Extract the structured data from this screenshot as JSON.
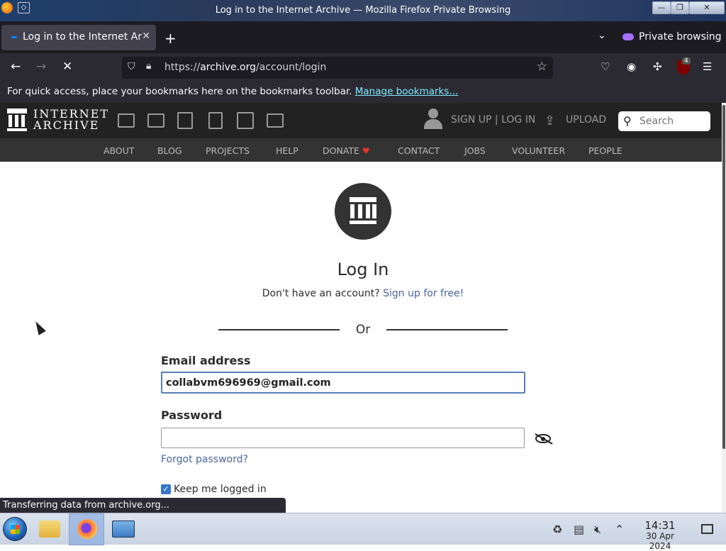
{
  "window": {
    "title": "Log in to the Internet Archive — Mozilla Firefox Private Browsing",
    "buttons": [
      "—",
      "❐",
      "✕"
    ]
  },
  "tabs": [
    {
      "title": "Log in to the Internet Archive",
      "close": "✕"
    }
  ],
  "tabstrip": {
    "new_tab": "+",
    "list_all": "⌄",
    "private_label": "Private browsing"
  },
  "navbar": {
    "back": "←",
    "forward": "→",
    "stop": "✕",
    "url_prefix": "https://",
    "url_host": "archive.org",
    "url_path": "/account/login",
    "ublock_count": "4"
  },
  "bookmarks": {
    "message": "For quick access, place your bookmarks here on the bookmarks toolbar.",
    "link": "Manage bookmarks..."
  },
  "ia_header": {
    "logo_line1": "INTERNET",
    "logo_line2": "ARCHIVE",
    "auth": "SIGN UP | LOG IN",
    "upload": "UPLOAD",
    "search_placeholder": "Search"
  },
  "ia_nav": [
    "ABOUT",
    "BLOG",
    "PROJECTS",
    "HELP",
    "DONATE",
    "CONTACT",
    "JOBS",
    "VOLUNTEER",
    "PEOPLE"
  ],
  "login": {
    "heading": "Log In",
    "no_account": "Don't have an account?",
    "signup_link": "Sign up for free!",
    "or": "Or",
    "email_label": "Email address",
    "email_value": "collabvm696969@gmail.com",
    "password_label": "Password",
    "password_value": "",
    "forgot": "Forgot password?",
    "keep_logged_in": "Keep me logged in",
    "keep_logged_in_checked": true
  },
  "status": "Transferring data from archive.org...",
  "taskbar": {
    "time": "14:31",
    "date": "30 Apr 2024"
  },
  "colors": {
    "ia_header_bg": "#222222",
    "ia_nav_bg": "#333333",
    "link_blue": "#4b64a0",
    "firefox_toolbar": "#2b2a33",
    "donate_heart": "#e5352b"
  }
}
